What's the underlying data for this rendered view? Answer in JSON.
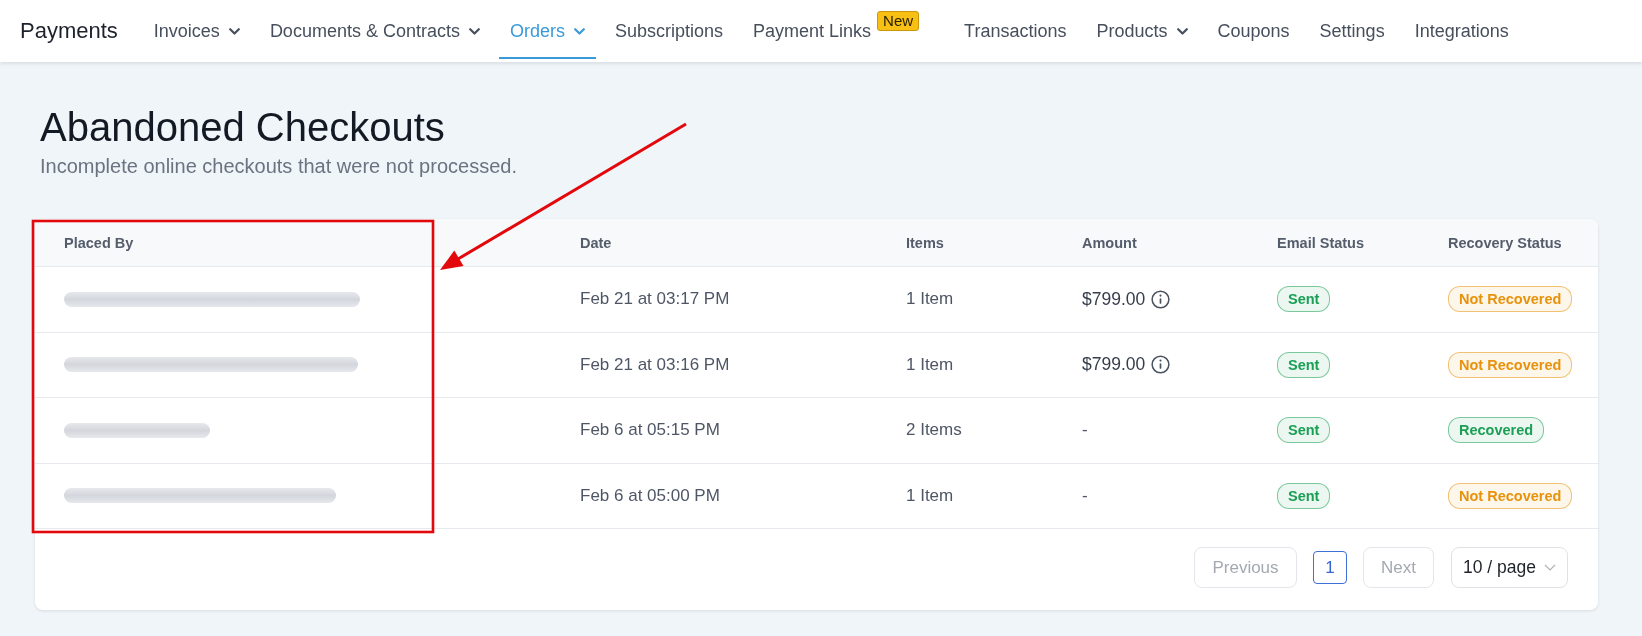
{
  "nav": {
    "brand": "Payments",
    "items": [
      {
        "label": "Invoices",
        "dropdown": true,
        "selected": false
      },
      {
        "label": "Documents & Contracts",
        "dropdown": true,
        "selected": false
      },
      {
        "label": "Orders",
        "dropdown": true,
        "selected": true
      },
      {
        "label": "Subscriptions",
        "dropdown": false,
        "selected": false
      },
      {
        "label": "Payment Links",
        "dropdown": false,
        "selected": false,
        "badge": "New"
      },
      {
        "label": "Transactions",
        "dropdown": false,
        "selected": false
      },
      {
        "label": "Products",
        "dropdown": true,
        "selected": false
      },
      {
        "label": "Coupons",
        "dropdown": false,
        "selected": false
      },
      {
        "label": "Settings",
        "dropdown": false,
        "selected": false
      },
      {
        "label": "Integrations",
        "dropdown": false,
        "selected": false
      }
    ]
  },
  "page": {
    "title": "Abandoned Checkouts",
    "subtitle": "Incomplete online checkouts that were not processed."
  },
  "table": {
    "columns": [
      "Placed By",
      "Date",
      "Items",
      "Amount",
      "Email Status",
      "Recovery Status"
    ],
    "rows": [
      {
        "date": "Feb 21 at 03:17 PM",
        "items": "1 Item",
        "amount": "$799.00",
        "amount_info": true,
        "email_status": {
          "label": "Sent",
          "color": "#1a9f55"
        },
        "recovery_status": {
          "label": "Not Recovered",
          "color": "#e8920c"
        }
      },
      {
        "date": "Feb 21 at 03:16 PM",
        "items": "1 Item",
        "amount": "$799.00",
        "amount_info": true,
        "email_status": {
          "label": "Sent",
          "color": "#1a9f55"
        },
        "recovery_status": {
          "label": "Not Recovered",
          "color": "#e8920c"
        }
      },
      {
        "date": "Feb 6 at 05:15 PM",
        "items": "2 Items",
        "amount": "-",
        "amount_info": false,
        "email_status": {
          "label": "Sent",
          "color": "#1a9f55"
        },
        "recovery_status": {
          "label": "Recovered",
          "color": "#1a9f55"
        }
      },
      {
        "date": "Feb 6 at 05:00 PM",
        "items": "1 Item",
        "amount": "-",
        "amount_info": false,
        "email_status": {
          "label": "Sent",
          "color": "#1a9f55"
        },
        "recovery_status": {
          "label": "Not Recovered",
          "color": "#e8920c"
        }
      }
    ]
  },
  "pagination": {
    "previous": {
      "label": "Previous",
      "disabled": true
    },
    "pages": [
      {
        "label": "1",
        "selected": true
      }
    ],
    "next": {
      "label": "Next",
      "disabled": true
    },
    "page_size": "10 / page"
  }
}
